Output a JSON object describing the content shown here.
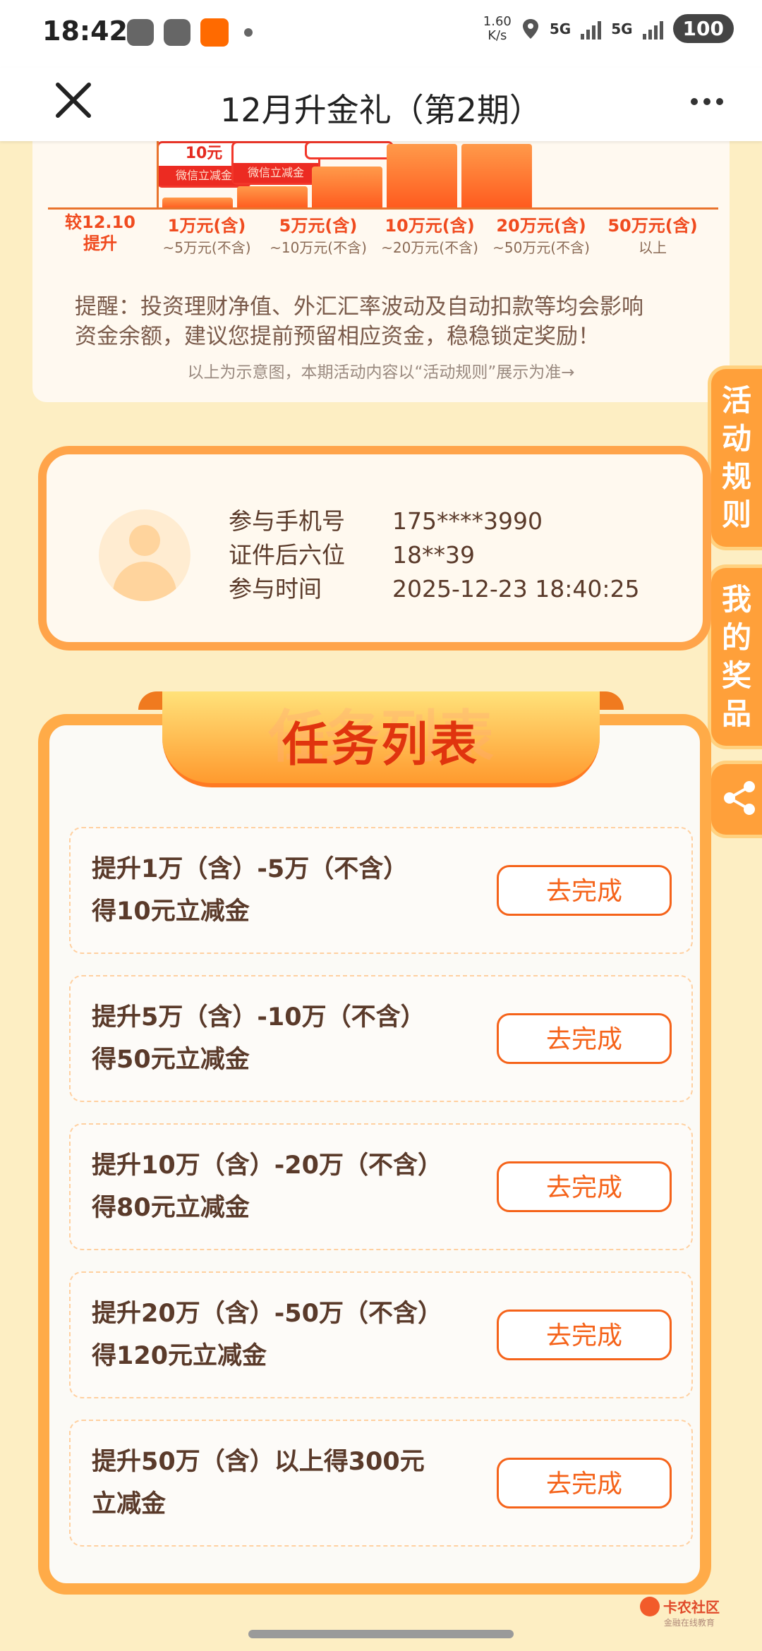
{
  "status_bar": {
    "time": "18:42",
    "speed_top": "1.60",
    "speed_bottom": "K/s",
    "sim1": "5G",
    "sim2": "5G",
    "battery": "100"
  },
  "app_bar": {
    "title": "12月升金礼（第2期）",
    "close_icon": "close-icon",
    "more_icon": "more-icon"
  },
  "chart": {
    "first_label_line1": "较12.10",
    "first_label_line2": "提升",
    "coupon_value": "10元",
    "coupon_label": "微信立减金",
    "tiers": [
      {
        "main": "1万元(含)",
        "sub": "~5万元(不含)"
      },
      {
        "main": "5万元(含)",
        "sub": "~10万元(不含)"
      },
      {
        "main": "10万元(含)",
        "sub": "~20万元(不含)"
      },
      {
        "main": "20万元(含)",
        "sub": "~50万元(不含)"
      },
      {
        "main": "50万元(含)",
        "sub": "以上"
      }
    ],
    "reminder_line1": "提醒：投资理财净值、外汇汇率波动及自动扣款等均会影响",
    "reminder_line2": "资金余额，建议您提前预留相应资金，稳稳锁定奖励！",
    "note": "以上为示意图，本期活动内容以“活动规则”展示为准→"
  },
  "side_tabs": {
    "rules": "活动规则",
    "prizes": "我的奖品",
    "share_icon": "share-icon"
  },
  "user": {
    "phone_label": "参与手机号",
    "phone_value": "175****3990",
    "id_label": "证件后六位",
    "id_value": "18**39",
    "time_label": "参与时间",
    "time_value": "2025-12-23 18:40:25"
  },
  "tasks": {
    "title": "任务列表",
    "items": [
      {
        "line1": "提升1万（含）-5万（不含）",
        "line2": "得10元立减金",
        "button": "去完成"
      },
      {
        "line1": "提升5万（含）-10万（不含）",
        "line2": "得50元立减金",
        "button": "去完成"
      },
      {
        "line1": "提升10万（含）-20万（不含）",
        "line2": "得80元立减金",
        "button": "去完成"
      },
      {
        "line1": "提升20万（含）-50万（不含）",
        "line2": "得120元立减金",
        "button": "去完成"
      },
      {
        "line1": "提升50万（含）以上得300元",
        "line2": "立减金",
        "button": "去完成"
      }
    ]
  },
  "watermark": {
    "name": "卡农社区",
    "tagline": "金融在线教育"
  }
}
